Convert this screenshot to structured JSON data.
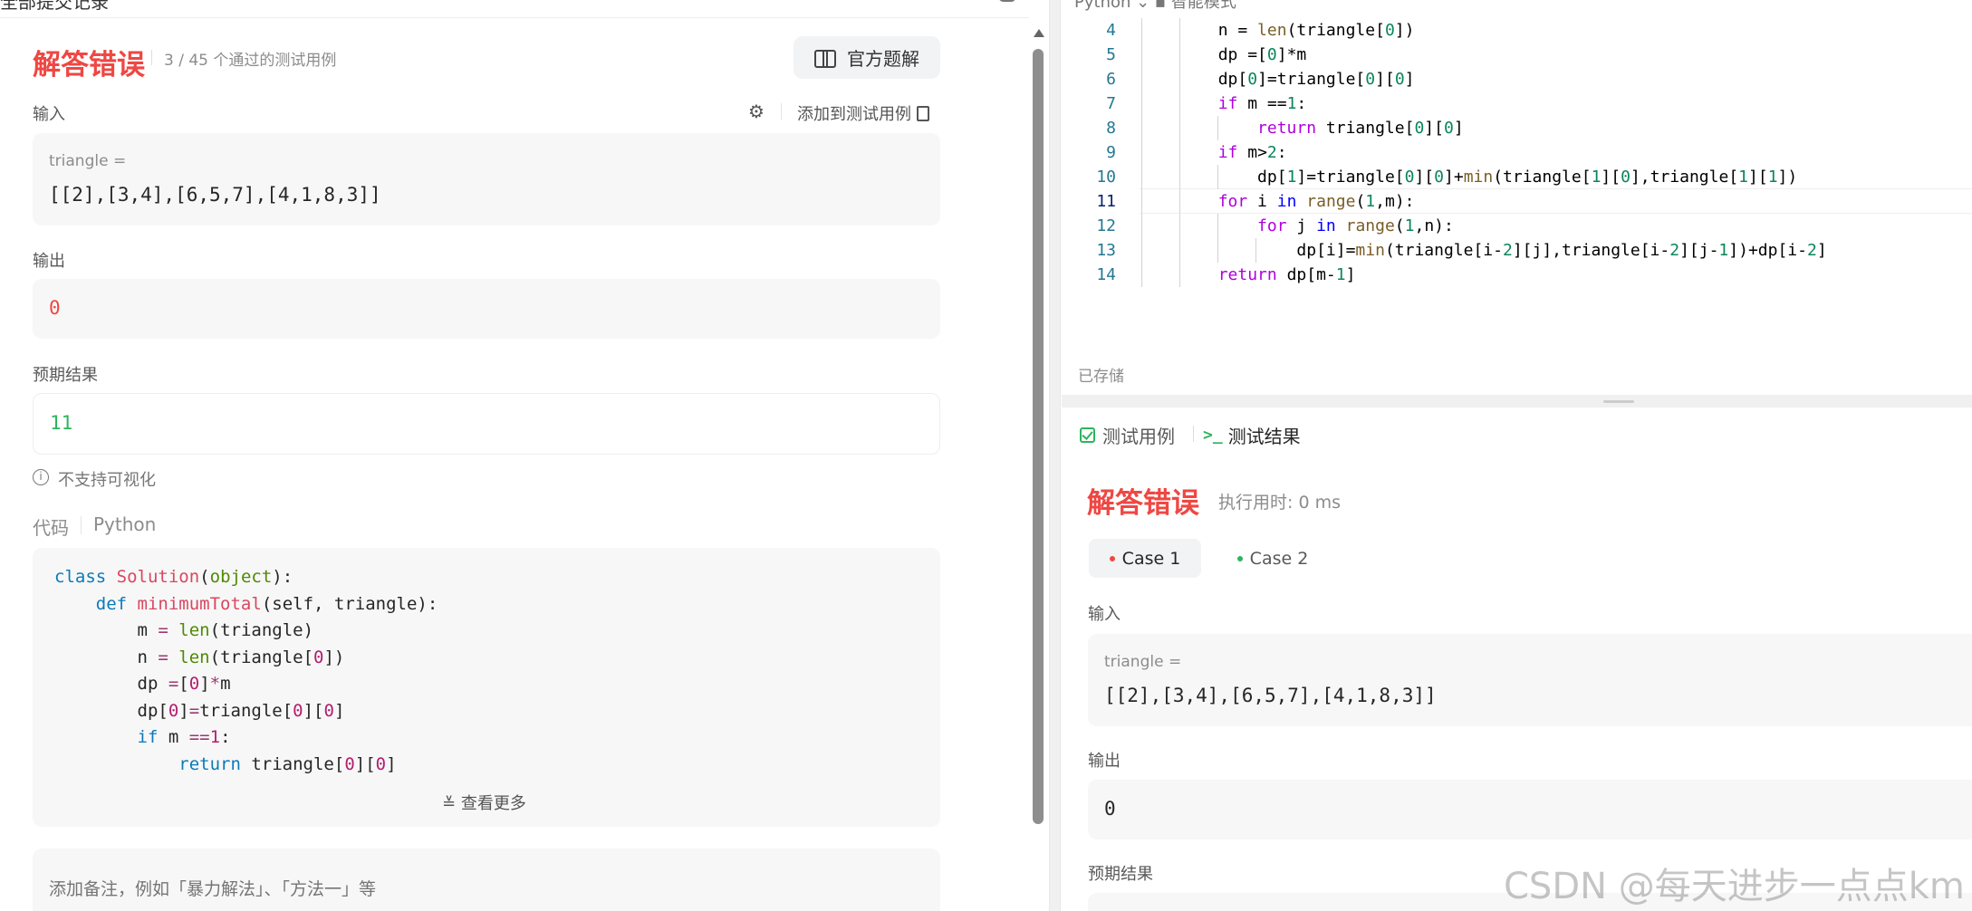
{
  "left": {
    "breadcrumb": "全部提交记录",
    "verdict": "解答错误",
    "passed_count": "3 / 45 个通过的测试用例",
    "official_solution_label": "官方题解",
    "input_label": "输入",
    "add_testcase_label": "添加到测试用例",
    "input_var": "triangle =",
    "input_value": "[[2],[3,4],[6,5,7],[4,1,8,3]]",
    "output_label": "输出",
    "output_value": "0",
    "expected_label": "预期结果",
    "expected_value": "11",
    "no_visual_label": "不支持可视化",
    "code_label": "代码",
    "code_lang": "Python",
    "show_more_label": "查看更多",
    "note_placeholder": "添加备注，例如「暴力解法」、「方法一」等"
  },
  "editor": {
    "top_label": "Python  ⌄    ▪ 智能模式",
    "line_numbers": [
      "4",
      "5",
      "6",
      "7",
      "8",
      "9",
      "10",
      "11",
      "12",
      "13",
      "14"
    ],
    "current_line": "11",
    "saved_label": "已存储"
  },
  "result": {
    "tab_testcase": "测试用例",
    "tab_result": "测试结果",
    "verdict": "解答错误",
    "runtime": "执行用时: 0 ms",
    "case1": "Case 1",
    "case2": "Case 2",
    "input_label": "输入",
    "input_var": "triangle =",
    "input_value": "[[2],[3,4],[6,5,7],[4,1,8,3]]",
    "output_label": "输出",
    "output_value": "0",
    "expected_label": "预期结果"
  },
  "watermark": "CSDN @每天进步一点点km",
  "colors": {
    "error": "#ef4743",
    "success": "#2db55d"
  }
}
